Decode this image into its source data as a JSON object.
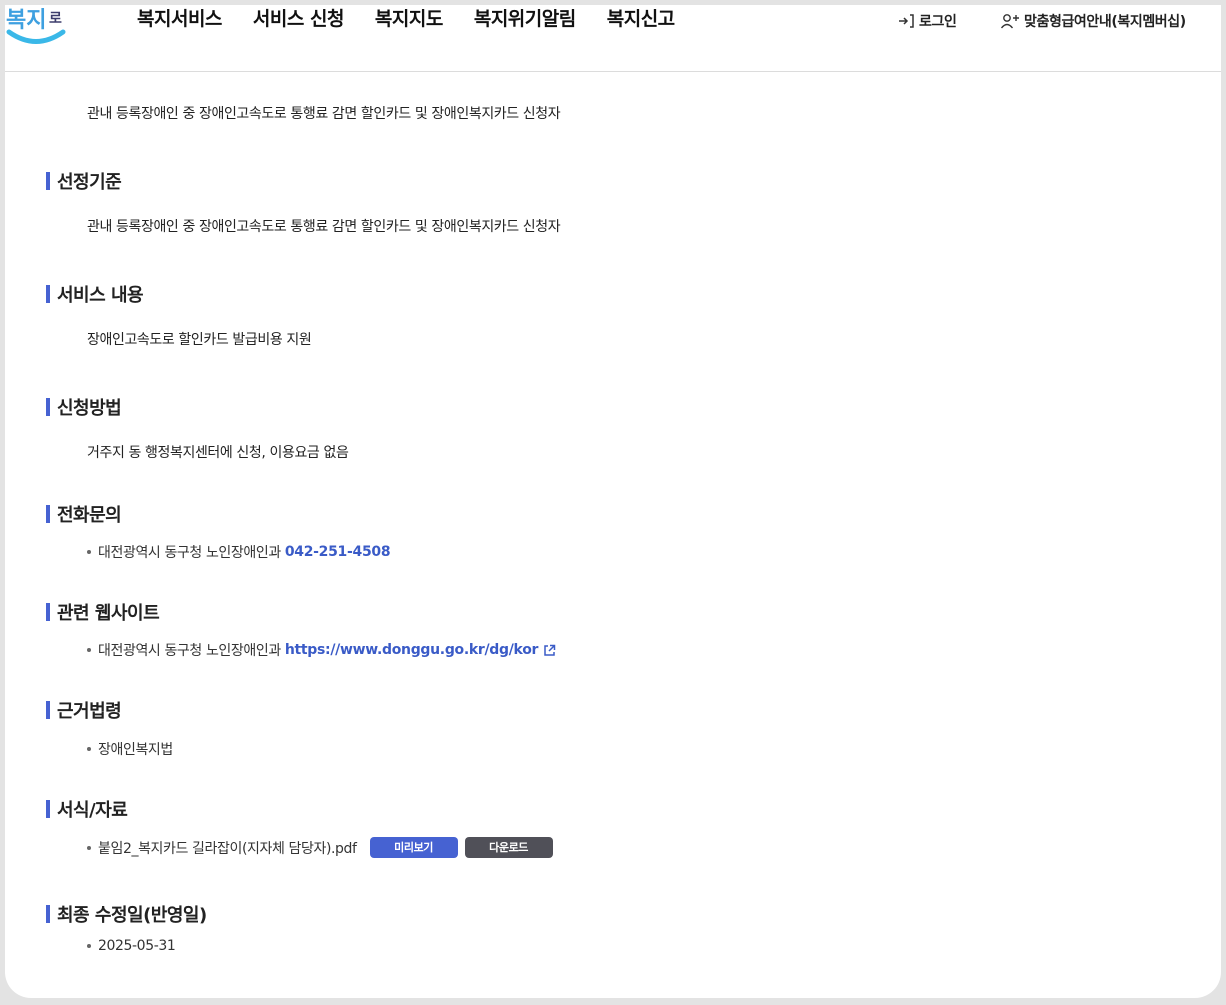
{
  "header": {
    "nav": [
      "복지서비스",
      "서비스 신청",
      "복지지도",
      "복지위기알림",
      "복지신고"
    ],
    "login_label": "로그인",
    "membership_label": "맞춤형급여안내(복지멤버십)"
  },
  "colors": {
    "accent": "#4662d2",
    "link": "#3a5bc7",
    "download_button": "#505058"
  },
  "intro_text": "관내 등록장애인 중 장애인고속도로 통행료 감면 할인카드 및 장애인복지카드 신청자",
  "sections": {
    "criteria": {
      "title": "선정기준",
      "text": "관내 등록장애인 중 장애인고속도로 통행료 감면 할인카드 및 장애인복지카드 신청자"
    },
    "service": {
      "title": "서비스 내용",
      "text": "장애인고속도로 할인카드 발급비용 지원"
    },
    "method": {
      "title": "신청방법",
      "text": "거주지 동 행정복지센터에 신청, 이용요금 없음"
    },
    "phone": {
      "title": "전화문의",
      "org": "대전광역시 동구청 노인장애인과",
      "number": "042-251-4508"
    },
    "website": {
      "title": "관련 웹사이트",
      "org": "대전광역시 동구청 노인장애인과",
      "url": "https://www.donggu.go.kr/dg/kor"
    },
    "law": {
      "title": "근거법령",
      "item": "장애인복지법"
    },
    "forms": {
      "title": "서식/자료",
      "file": "붙임2_복지카드 길라잡이(지자체 담당자).pdf",
      "preview_label": "미리보기",
      "download_label": "다운로드"
    },
    "updated": {
      "title": "최종 수정일(반영일)",
      "date": "2025-05-31"
    }
  }
}
